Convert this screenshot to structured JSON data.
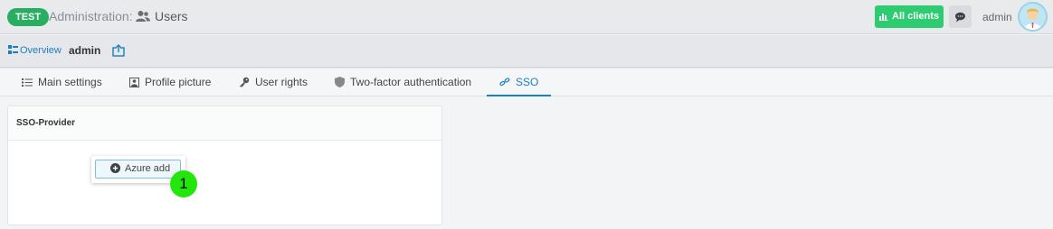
{
  "header": {
    "env_badge": "TEST",
    "crumb_admin": "Administration:",
    "crumb_users": "Users",
    "all_clients_label": "All clients",
    "user_name": "admin"
  },
  "subheader": {
    "overview_label": "Overview",
    "title": "admin"
  },
  "tabs": [
    {
      "label": "Main settings",
      "icon": "list-icon"
    },
    {
      "label": "Profile picture",
      "icon": "picture-icon"
    },
    {
      "label": "User rights",
      "icon": "key-icon"
    },
    {
      "label": "Two-factor authentication",
      "icon": "shield-icon"
    },
    {
      "label": "SSO",
      "icon": "sso-icon",
      "active": true
    }
  ],
  "panel": {
    "title": "SSO-Provider",
    "azure_add_label": "Azure add"
  },
  "annotation": {
    "step_number": "1"
  },
  "colors": {
    "badge_green": "#27ae60",
    "clients_green": "#2ecc71",
    "accent_blue": "#1c7fbf",
    "marker_green": "#23e60c"
  }
}
